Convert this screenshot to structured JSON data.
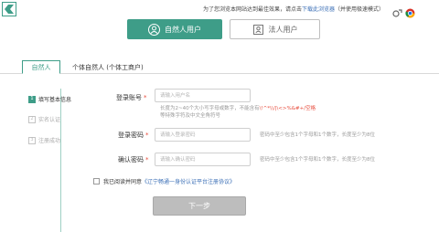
{
  "header": {
    "browser_tip": "为了您浏览本网站达到最佳效果，请点击下载此浏览器（并使用极速模式）",
    "tip_link": "下载此浏览器"
  },
  "user_types": {
    "natural_person": "自然人用户",
    "legal_person": "法人用户"
  },
  "tabs": [
    {
      "label": "自然人",
      "active": true
    },
    {
      "label": "个体自然人 (个体工商户)",
      "active": false
    }
  ],
  "steps": [
    {
      "num": "1",
      "label": "填写基本信息",
      "active": true
    },
    {
      "num": "2",
      "label": "实名认证",
      "active": false
    },
    {
      "num": "3",
      "label": "注册成功",
      "active": false
    }
  ],
  "form": {
    "account": {
      "label": "登录账号",
      "required_mark": "*",
      "placeholder": "请输入用户名",
      "hint_line1": "长度为2~40个大小写字母或数字，不能含有",
      "hint_special": "\\!^*\\\\/|\\<>%&#+/空格",
      "hint_line2": "等特殊字符及中文全角符号"
    },
    "password": {
      "label": "登录密码",
      "required_mark": "*",
      "placeholder": "请输入登录密码",
      "hint": "密码中至少包含1个字母和1个数字，长度至少为8位"
    },
    "confirm_password": {
      "label": "确认密码",
      "required_mark": "*",
      "placeholder": "请输入确认密码",
      "hint": "密码中至少包含1个字母和1个数字，长度至少为8位"
    },
    "agreement": {
      "prefix": "我已阅读并同意",
      "link": "《辽宁畅通一身份认证平台注册协议》"
    },
    "next_button": "下一步"
  },
  "colors": {
    "accent": "#3e9d88",
    "disabled_button": "#bdbdbd",
    "link": "#3b6fb6",
    "required": "#e74c3c"
  },
  "icons": {
    "logo": "site-logo-icon",
    "natural_person": "person-icon",
    "legal_person": "id-card-icon",
    "toolbar_a": "browser-tool-icon",
    "toolbar_b": "chrome-browser-icon"
  }
}
